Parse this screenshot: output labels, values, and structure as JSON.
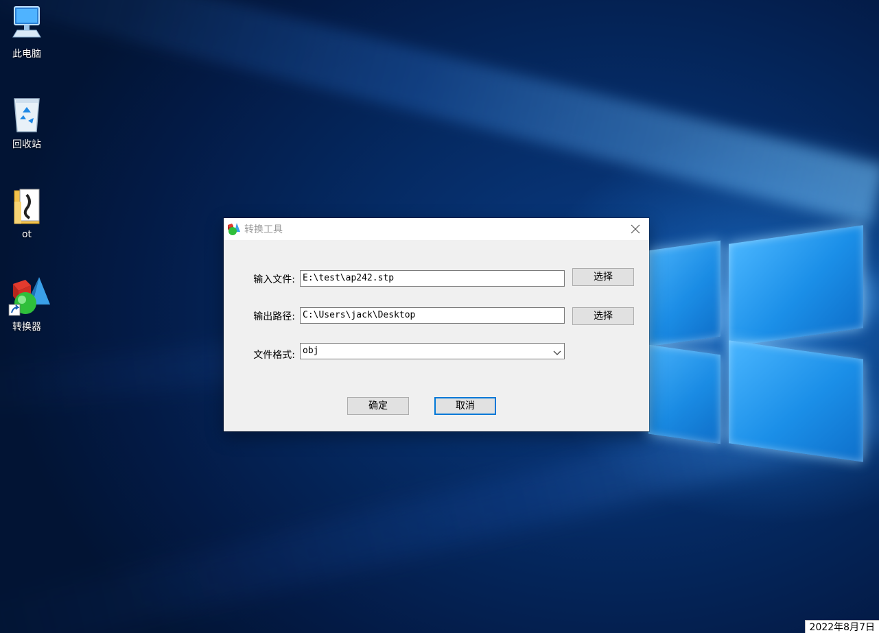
{
  "desktop": {
    "icons": [
      {
        "label": "此电脑",
        "icon": "computer-icon"
      },
      {
        "label": "回收站",
        "icon": "recycle-bin-icon"
      },
      {
        "label": "ot",
        "icon": "folder-icon"
      },
      {
        "label": "转换器",
        "icon": "converter-app-icon"
      }
    ]
  },
  "dialog": {
    "title": "转换工具",
    "title_icon": "converter-app-icon",
    "close_icon": "close-icon",
    "input_file": {
      "label": "输入文件:",
      "value": "E:\\test\\ap242.stp",
      "button": "选择"
    },
    "output_path": {
      "label": "输出路径:",
      "value": "C:\\Users\\jack\\Desktop",
      "button": "选择"
    },
    "file_format": {
      "label": "文件格式:",
      "value": "obj",
      "icon": "chevron-down-icon"
    },
    "ok_button": "确定",
    "cancel_button": "取消"
  },
  "taskbar": {
    "date": "2022年8月7日"
  },
  "colors": {
    "accent": "#0078d7",
    "dialog_bg": "#f0f0f0",
    "desktop_bg": "#052a63"
  }
}
